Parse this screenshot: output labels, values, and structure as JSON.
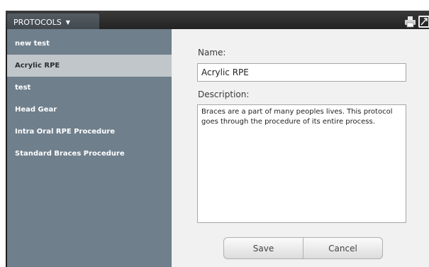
{
  "header": {
    "menu_label": "PROTOCOLS",
    "menu_caret": "▼"
  },
  "toolbar": {
    "icons": [
      "print-icon",
      "expand-icon"
    ]
  },
  "sidebar": {
    "items": [
      {
        "label": "new test"
      },
      {
        "label": "Acrylic RPE",
        "selected": true
      },
      {
        "label": "test"
      },
      {
        "label": "Head Gear"
      },
      {
        "label": "Intra Oral RPE Procedure"
      },
      {
        "label": "Standard Braces Procedure"
      }
    ]
  },
  "form": {
    "name_label": "Name:",
    "name_value": "Acrylic RPE",
    "description_label": "Description:",
    "description_value": "Braces are a part of many peoples lives. This protocol goes through the procedure of its entire process.",
    "save_label": "Save",
    "cancel_label": "Cancel"
  },
  "colors": {
    "topbar": "#1f1f1f",
    "sidebar": "#6f7f8c",
    "sidebar_selected": "#c0c6ca",
    "content": "#f1f1f1"
  }
}
